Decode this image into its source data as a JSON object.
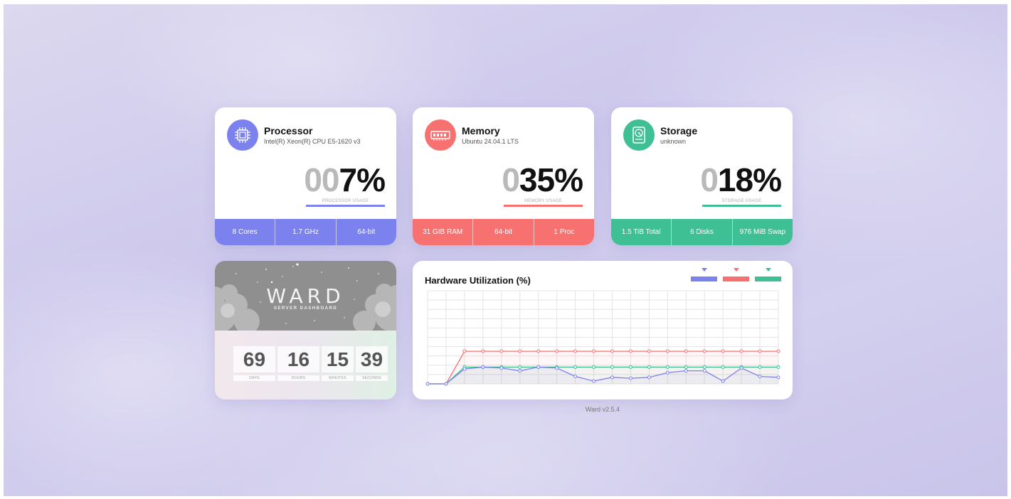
{
  "colors": {
    "processor": "#7b82ee",
    "memory": "#f87171",
    "storage": "#3ebf94"
  },
  "processor": {
    "title": "Processor",
    "subtitle": "Intel(R) Xeon(R) CPU E5-1620 v3",
    "icon": "cpu-icon",
    "percent_zeros": "00",
    "percent_value": "7%",
    "usage_label": "PROCESSOR USAGE",
    "stats": [
      "8 Cores",
      "1.7 GHz",
      "64-bit"
    ]
  },
  "memory": {
    "title": "Memory",
    "subtitle": "Ubuntu 24.04.1 LTS",
    "icon": "ram-icon",
    "percent_zeros": "0",
    "percent_value": "35%",
    "usage_label": "MEMORY USAGE",
    "stats": [
      "31 GIB RAM",
      "64-bit",
      "1 Proc"
    ]
  },
  "storage": {
    "title": "Storage",
    "subtitle": "unknown",
    "icon": "hard-drive-icon",
    "percent_zeros": "0",
    "percent_value": "18%",
    "usage_label": "STORAGE USAGE",
    "stats": [
      "1.5 TiB Total",
      "6 Disks",
      "976 MiB Swap"
    ]
  },
  "uptime": {
    "logo": "WARD",
    "logo_sub": "SERVER DASHBOARD",
    "blocks": [
      {
        "value": "69",
        "label": "DAYS"
      },
      {
        "value": "16",
        "label": "HOURS"
      },
      {
        "value": "15",
        "label": "MINUTES"
      },
      {
        "value": "39",
        "label": "SECONDS"
      }
    ]
  },
  "chart": {
    "title": "Hardware Utilization (%)"
  },
  "chart_data": {
    "type": "line",
    "title": "Hardware Utilization (%)",
    "ylim": [
      0,
      100
    ],
    "x": [
      1,
      2,
      3,
      4,
      5,
      6,
      7,
      8,
      9,
      10,
      11,
      12,
      13,
      14,
      15,
      16,
      17,
      18,
      19,
      20
    ],
    "grid": true,
    "legend": "top-right",
    "series": [
      {
        "color": "#f87171",
        "values": [
          0,
          0,
          35,
          35,
          35,
          35,
          35,
          35,
          35,
          35,
          35,
          35,
          35,
          35,
          35,
          35,
          35,
          35,
          35,
          35
        ]
      },
      {
        "color": "#3ebf94",
        "values": [
          0,
          0,
          18,
          18,
          18,
          18,
          18,
          18,
          18,
          18,
          18,
          18,
          18,
          18,
          18,
          18,
          18,
          18,
          18,
          18
        ]
      },
      {
        "color": "#7b82ee",
        "values": [
          0,
          0,
          16,
          18,
          17,
          14,
          18,
          17,
          8,
          3,
          7,
          6,
          7,
          12,
          14,
          14,
          3,
          17,
          8,
          7
        ]
      }
    ]
  },
  "footer": {
    "version": "Ward v2.5.4"
  }
}
